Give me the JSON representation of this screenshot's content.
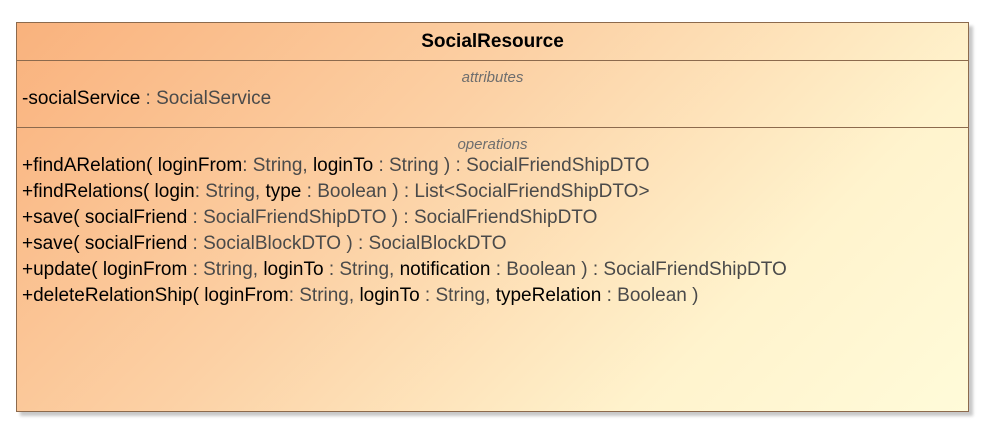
{
  "class_name": "SocialResource",
  "attributes_label": "attributes",
  "operations_label": "operations",
  "attributes": [
    {
      "name": "-socialService",
      "sep": " : ",
      "type": "SocialService"
    }
  ],
  "operations": [
    {
      "parts": [
        {
          "text": "+findARelation( loginFrom",
          "kind": "name"
        },
        {
          "text": ": String, ",
          "kind": "type"
        },
        {
          "text": "loginTo",
          "kind": "name"
        },
        {
          "text": " : String ) : SocialFriendShipDTO",
          "kind": "type"
        }
      ]
    },
    {
      "parts": [
        {
          "text": "+findRelations( login",
          "kind": "name"
        },
        {
          "text": ": String, ",
          "kind": "type"
        },
        {
          "text": "type",
          "kind": "name"
        },
        {
          "text": " : Boolean ) : List<SocialFriendShipDTO>",
          "kind": "type"
        }
      ]
    },
    {
      "parts": [
        {
          "text": "+save( socialFriend",
          "kind": "name"
        },
        {
          "text": " : SocialFriendShipDTO ) : SocialFriendShipDTO",
          "kind": "type"
        }
      ]
    },
    {
      "parts": [
        {
          "text": "+save( socialFriend",
          "kind": "name"
        },
        {
          "text": " : SocialBlockDTO ) : SocialBlockDTO",
          "kind": "type"
        }
      ]
    },
    {
      "parts": [
        {
          "text": "+update( loginFrom",
          "kind": "name"
        },
        {
          "text": " : String, ",
          "kind": "type"
        },
        {
          "text": "loginTo",
          "kind": "name"
        },
        {
          "text": " : String, ",
          "kind": "type"
        },
        {
          "text": "notification",
          "kind": "name"
        },
        {
          "text": " : Boolean ) : SocialFriendShipDTO",
          "kind": "type"
        }
      ]
    },
    {
      "parts": [
        {
          "text": "+deleteRelationShip( loginFrom",
          "kind": "name"
        },
        {
          "text": ": String, ",
          "kind": "type"
        },
        {
          "text": "loginTo",
          "kind": "name"
        },
        {
          "text": " : String, ",
          "kind": "type"
        },
        {
          "text": "typeRelation",
          "kind": "name"
        },
        {
          "text": " : Boolean )",
          "kind": "type"
        }
      ]
    }
  ],
  "colors": {
    "border": "#8c6a4d",
    "gradient_start": "#f9b27d",
    "gradient_end": "#fffbd9",
    "compartment_label": "#6e6e6e",
    "type_text": "#4a4a4a"
  }
}
